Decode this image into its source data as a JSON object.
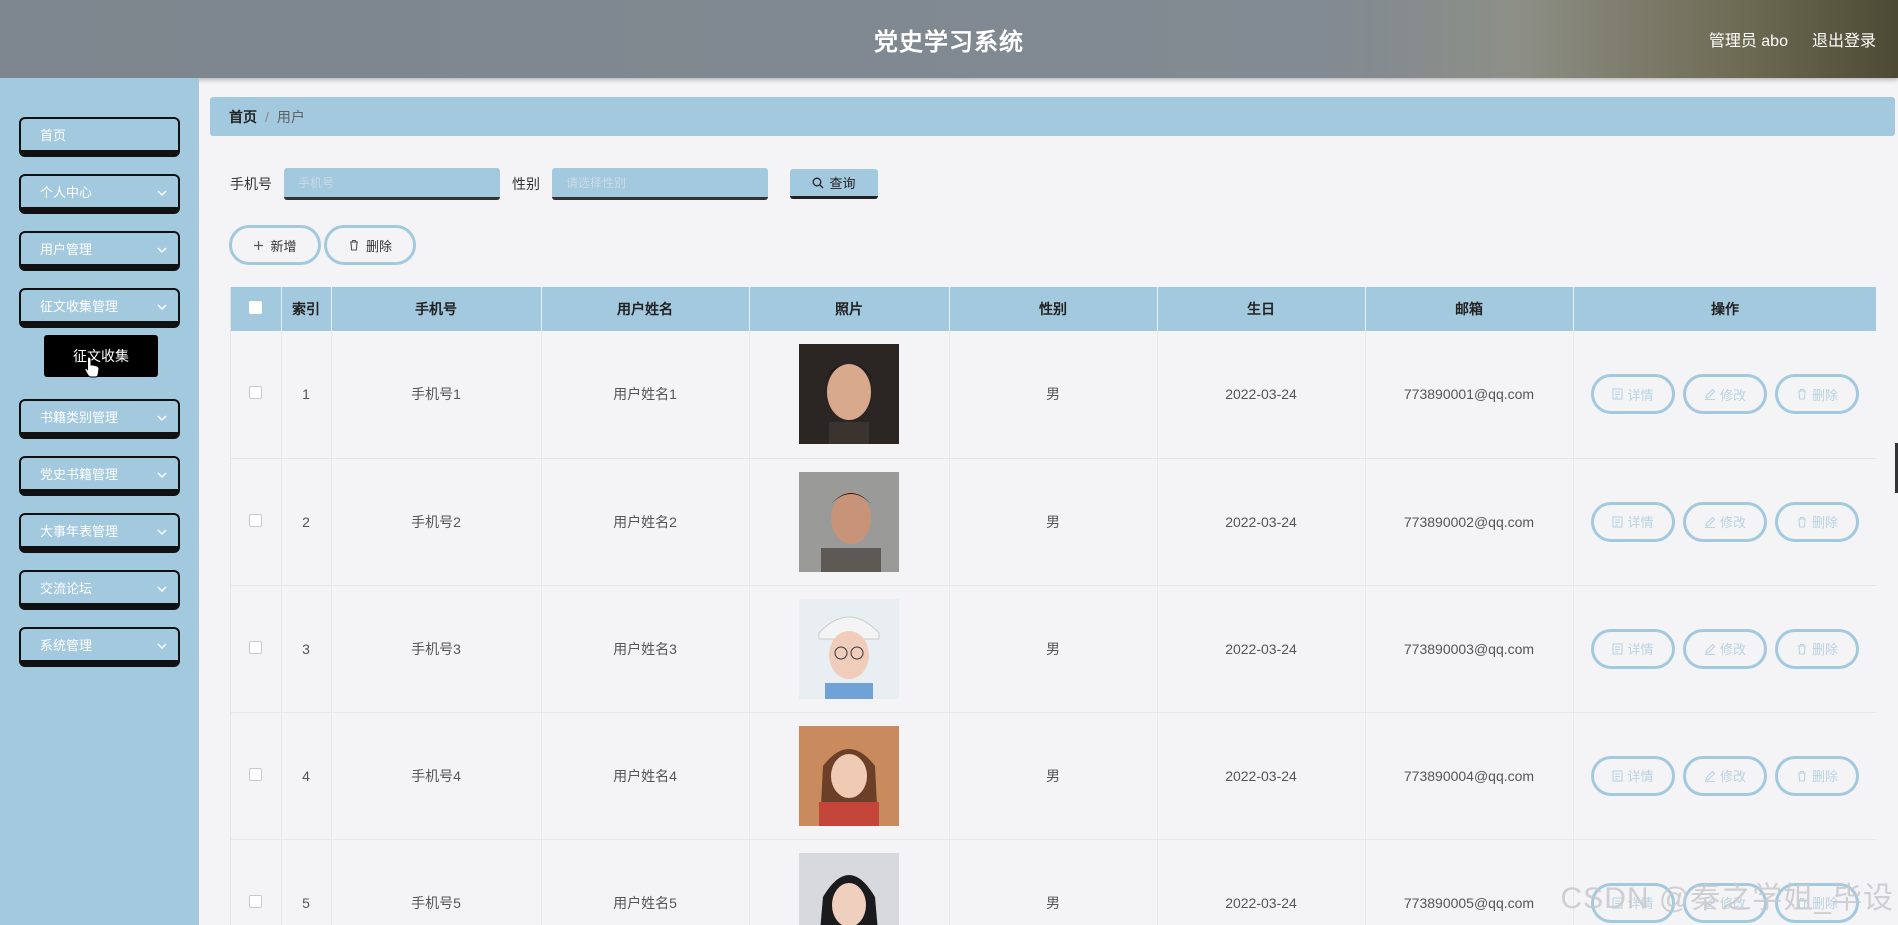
{
  "header": {
    "title": "党史学习系统",
    "user": "管理员 abo",
    "logout": "退出登录"
  },
  "sidebar": {
    "items": [
      {
        "label": "首页",
        "chevron": false
      },
      {
        "label": "个人中心",
        "chevron": true
      },
      {
        "label": "用户管理",
        "chevron": true
      },
      {
        "label": "征文收集管理",
        "chevron": true
      },
      {
        "label": "书籍类别管理",
        "chevron": true
      },
      {
        "label": "党史书籍管理",
        "chevron": true
      },
      {
        "label": "大事年表管理",
        "chevron": true
      },
      {
        "label": "交流论坛",
        "chevron": true
      },
      {
        "label": "系统管理",
        "chevron": true
      }
    ],
    "submenu_label": "征文收集"
  },
  "breadcrumb": {
    "home": "首页",
    "current": "用户"
  },
  "search": {
    "phone_label": "手机号",
    "phone_placeholder": "手机号",
    "gender_label": "性别",
    "gender_placeholder": "请选择性别",
    "query_button": "查询"
  },
  "actions": {
    "add": "新增",
    "delete": "删除"
  },
  "table": {
    "headers": [
      "索引",
      "手机号",
      "用户姓名",
      "照片",
      "性别",
      "生日",
      "邮箱",
      "操作"
    ],
    "row_buttons": {
      "detail": "详情",
      "edit": "修改",
      "delete": "删除"
    },
    "rows": [
      {
        "index": "1",
        "phone": "手机号1",
        "name": "用户姓名1",
        "gender": "男",
        "birthday": "2022-03-24",
        "email": "773890001@qq.com"
      },
      {
        "index": "2",
        "phone": "手机号2",
        "name": "用户姓名2",
        "gender": "男",
        "birthday": "2022-03-24",
        "email": "773890002@qq.com"
      },
      {
        "index": "3",
        "phone": "手机号3",
        "name": "用户姓名3",
        "gender": "男",
        "birthday": "2022-03-24",
        "email": "773890003@qq.com"
      },
      {
        "index": "4",
        "phone": "手机号4",
        "name": "用户姓名4",
        "gender": "男",
        "birthday": "2022-03-24",
        "email": "773890004@qq.com"
      },
      {
        "index": "5",
        "phone": "手机号5",
        "name": "用户姓名5",
        "gender": "男",
        "birthday": "2022-03-24",
        "email": "773890005@qq.com"
      }
    ]
  },
  "watermark": "CSDN @秦之学姐_毕设",
  "colors": {
    "accent": "#a3c9df",
    "header": "#7d858e"
  }
}
